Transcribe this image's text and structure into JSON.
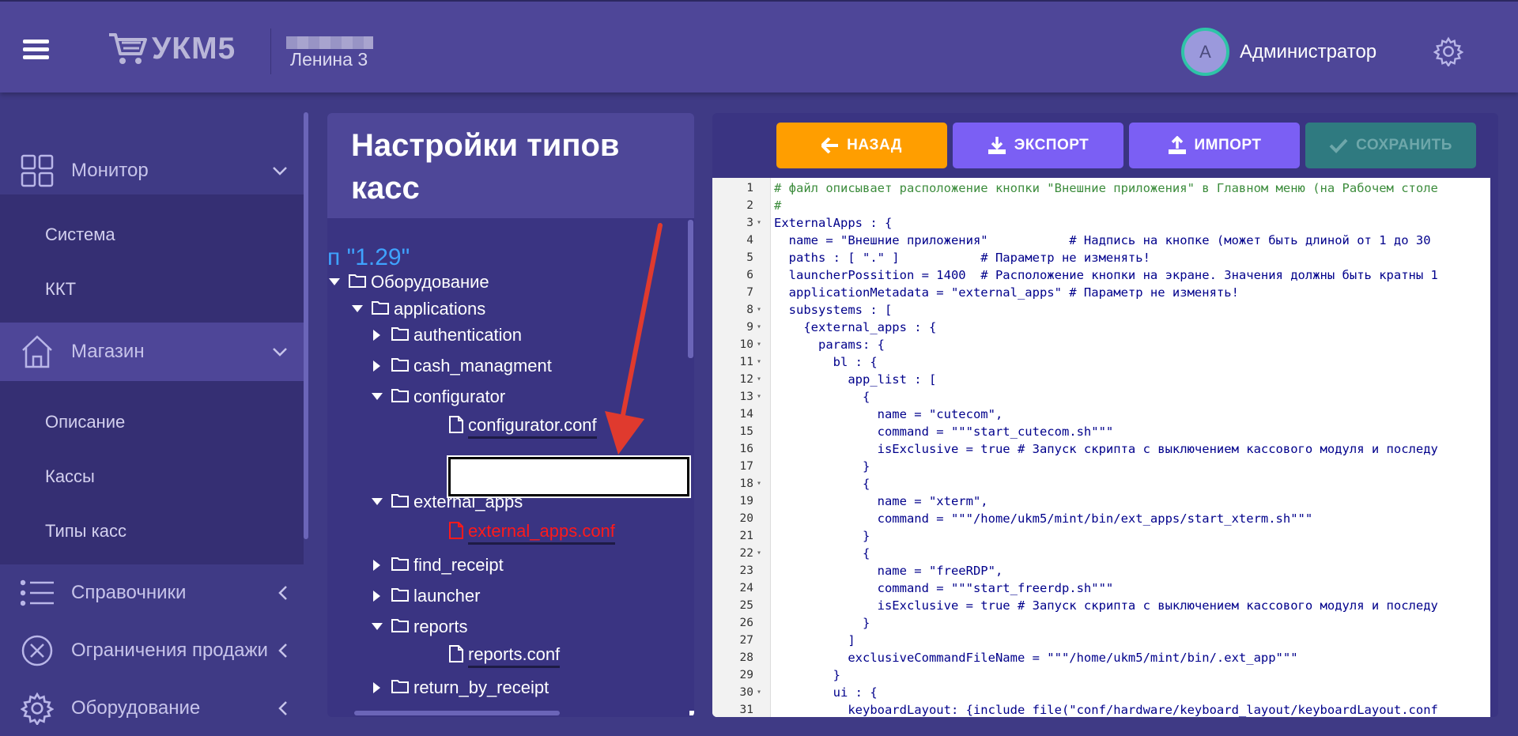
{
  "header": {
    "logo_text": "УКМ5",
    "store_name": "Ленина 3",
    "avatar_letter": "А",
    "user_name": "Администратор"
  },
  "sidebar": {
    "items": [
      {
        "label": "Монитор",
        "icon": "dashboard-grid-icon",
        "expanded": true
      },
      {
        "label": "Магазин",
        "icon": "store-house-icon",
        "expanded": true
      },
      {
        "label": "Справочники",
        "icon": "list-icon",
        "expanded": false
      },
      {
        "label": "Ограничения продажи",
        "icon": "restriction-icon",
        "expanded": false
      },
      {
        "label": "Оборудование",
        "icon": "gear-icon",
        "expanded": false
      }
    ],
    "monitor_sub": [
      "Система",
      "ККТ"
    ],
    "store_sub": [
      "Описание",
      "Кассы",
      "Типы касс"
    ]
  },
  "tree_panel": {
    "title": "Настройки типов касс",
    "type_label": "п \"1.29\"",
    "nodes": [
      {
        "label": "Оборудование",
        "kind": "folder",
        "state": "open"
      },
      {
        "label": "applications",
        "kind": "folder",
        "state": "open"
      },
      {
        "label": "authentication",
        "kind": "folder",
        "state": "closed"
      },
      {
        "label": "cash_managment",
        "kind": "folder",
        "state": "closed"
      },
      {
        "label": "configurator",
        "kind": "folder",
        "state": "open"
      },
      {
        "label": "configurator.conf",
        "kind": "file"
      },
      {
        "label": "external_apps",
        "kind": "folder",
        "state": "open"
      },
      {
        "label": "external_apps.conf",
        "kind": "file",
        "status": "error"
      },
      {
        "label": "find_receipt",
        "kind": "folder",
        "state": "closed"
      },
      {
        "label": "launcher",
        "kind": "folder",
        "state": "closed"
      },
      {
        "label": "reports",
        "kind": "folder",
        "state": "open"
      },
      {
        "label": "reports.conf",
        "kind": "file"
      },
      {
        "label": "return_by_receipt",
        "kind": "folder",
        "state": "closed"
      }
    ],
    "new_item_value": ""
  },
  "toolbar": {
    "back_label": "НАЗАД",
    "export_label": "ЭКСПОРТ",
    "import_label": "ИМПОРТ",
    "save_label": "СОХРАНИТЬ"
  },
  "colors": {
    "back": "#ff9e00",
    "export": "#7b5ff4",
    "import": "#7b5ff4",
    "save_disabled": "#2f7a80",
    "error_file": "#ff1a1a",
    "type_label": "#3fa3ff"
  },
  "editor": {
    "lines": [
      {
        "n": "1",
        "fold": "",
        "text": "# файл описывает расположение кнопки \"Внешние приложения\" в Главном меню (на Рабочем столе"
      },
      {
        "n": "2",
        "fold": "",
        "text": "#"
      },
      {
        "n": "3",
        "fold": "▾",
        "text": "ExternalApps : {"
      },
      {
        "n": "4",
        "fold": "",
        "text": "  name = \"Внешние приложения\"           # Надпись на кнопке (может быть длиной от 1 до 30"
      },
      {
        "n": "5",
        "fold": "",
        "text": "  paths : [ \".\" ]           # Параметр не изменять!"
      },
      {
        "n": "6",
        "fold": "",
        "text": "  launcherPossition = 1400  # Расположение кнопки на экране. Значения должны быть кратны 1"
      },
      {
        "n": "7",
        "fold": "",
        "text": "  applicationMetadata = \"external_apps\" # Параметр не изменять!"
      },
      {
        "n": "8",
        "fold": "▾",
        "text": "  subsystems : ["
      },
      {
        "n": "9",
        "fold": "▾",
        "text": "    {external_apps : {"
      },
      {
        "n": "10",
        "fold": "▾",
        "text": "      params: {"
      },
      {
        "n": "11",
        "fold": "▾",
        "text": "        bl : {"
      },
      {
        "n": "12",
        "fold": "▾",
        "text": "          app_list : ["
      },
      {
        "n": "13",
        "fold": "▾",
        "text": "            {"
      },
      {
        "n": "14",
        "fold": "",
        "text": "              name = \"cutecom\","
      },
      {
        "n": "15",
        "fold": "",
        "text": "              command = \"\"\"start_cutecom.sh\"\"\""
      },
      {
        "n": "16",
        "fold": "",
        "text": "              isExclusive = true # Запуск скрипта с выключением кассового модуля и последу"
      },
      {
        "n": "17",
        "fold": "",
        "text": "            }"
      },
      {
        "n": "18",
        "fold": "▾",
        "text": "            {"
      },
      {
        "n": "19",
        "fold": "",
        "text": "              name = \"xterm\","
      },
      {
        "n": "20",
        "fold": "",
        "text": "              command = \"\"\"/home/ukm5/mint/bin/ext_apps/start_xterm.sh\"\"\""
      },
      {
        "n": "21",
        "fold": "",
        "text": "            }"
      },
      {
        "n": "22",
        "fold": "▾",
        "text": "            {"
      },
      {
        "n": "23",
        "fold": "",
        "text": "              name = \"freeRDP\","
      },
      {
        "n": "24",
        "fold": "",
        "text": "              command = \"\"\"start_freerdp.sh\"\"\""
      },
      {
        "n": "25",
        "fold": "",
        "text": "              isExclusive = true # Запуск скрипта с выключением кассового модуля и последу"
      },
      {
        "n": "26",
        "fold": "",
        "text": "            }"
      },
      {
        "n": "27",
        "fold": "",
        "text": "          ]"
      },
      {
        "n": "28",
        "fold": "",
        "text": "          exclusiveCommandFileName = \"\"\"/home/ukm5/mint/bin/.ext_app\"\"\""
      },
      {
        "n": "29",
        "fold": "",
        "text": "        }"
      },
      {
        "n": "30",
        "fold": "▾",
        "text": "        ui : {"
      },
      {
        "n": "31",
        "fold": "",
        "text": "          keyboardLayout: {include file(\"conf/hardware/keyboard_layout/keyboardLayout.conf"
      }
    ]
  }
}
